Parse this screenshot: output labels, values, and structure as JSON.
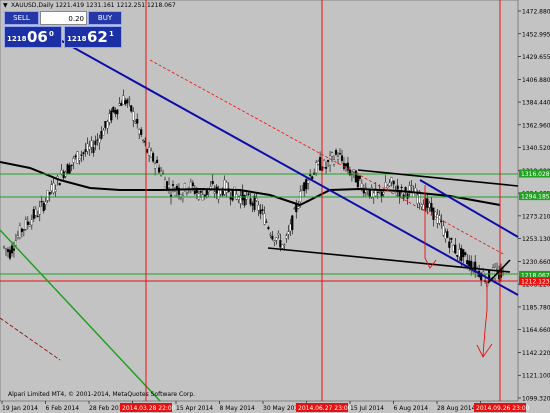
{
  "window": {
    "symbol_arrow": "▼",
    "title": "XAUUSD,Daily  1221.419 1231.161 1212.251 1218.067"
  },
  "trade_panel": {
    "sell_label": "SELL",
    "buy_label": "BUY",
    "lot_value": "0.20",
    "bid": {
      "small": "1218",
      "big": "06",
      "sup": "0"
    },
    "ask": {
      "small": "1218",
      "big": "62",
      "sup": "1"
    }
  },
  "copyright": "Alpari Limited MT4, © 2001-2014, MetaQuotes Software Corp.",
  "price_axis": {
    "labels": [
      "1472.880",
      "1452.995",
      "1429.655",
      "1406.880",
      "1384.440",
      "1362.960",
      "1340.520",
      "1318.080",
      "1294.685",
      "1273.210",
      "1253.130",
      "1230.660",
      "1208.220",
      "1185.780",
      "1164.660",
      "1142.220",
      "1121.100",
      "1099.320"
    ],
    "highlight_labels": [
      {
        "text": "1316.028",
        "price": 1316.0,
        "color": "#22a022"
      },
      {
        "text": "1294.185",
        "price": 1294.2,
        "color": "#22a022"
      },
      {
        "text": "1218.067",
        "price": 1218.1,
        "color": "#22a022"
      },
      {
        "text": "1212.123",
        "price": 1212.1,
        "color": "#e81010"
      }
    ]
  },
  "time_axis": {
    "labels": [
      "19 Jan 2014",
      "6 Feb 2014",
      "28 Feb 2014",
      "19 Mar 2014",
      "15 Apr 2014",
      "8 May 2014",
      "30 May 2014",
      "19 Jun 2014",
      "15 Jul 2014",
      "6 Aug 2014",
      "28 Aug 2014",
      "17 Sep 2014"
    ],
    "highlight_labels": [
      {
        "text": "2014.03.28 22:00"
      },
      {
        "text": "2014.06.27 23:00"
      },
      {
        "text": "2014.09.26 23:00"
      }
    ]
  },
  "colors": {
    "background": "#c3c3c3",
    "bull": "#ffffff",
    "bear": "#000000",
    "channel": "#0d0da8",
    "support": "#22a022",
    "resistance": "#e81010",
    "ma": "#000000"
  },
  "chart_data": {
    "type": "candlestick",
    "symbol": "XAUUSD",
    "timeframe": "Daily",
    "ylim": [
      1099.32,
      1472.88
    ],
    "ohlc_last": {
      "open": 1221.419,
      "high": 1231.161,
      "low": 1212.251,
      "close": 1218.067
    },
    "price_path": [
      1245,
      1240,
      1252,
      1262,
      1268,
      1275,
      1280,
      1290,
      1300,
      1308,
      1318,
      1322,
      1330,
      1335,
      1338,
      1342,
      1352,
      1360,
      1372,
      1380,
      1388,
      1382,
      1368,
      1352,
      1338,
      1330,
      1322,
      1310,
      1300,
      1302,
      1298,
      1305,
      1300,
      1295,
      1298,
      1302,
      1296,
      1303,
      1298,
      1295,
      1293,
      1290,
      1288,
      1280,
      1270,
      1258,
      1252,
      1245,
      1262,
      1282,
      1300,
      1312,
      1318,
      1325,
      1322,
      1330,
      1335,
      1325,
      1318,
      1312,
      1305,
      1300,
      1294,
      1296,
      1302,
      1306,
      1301,
      1296,
      1300,
      1296,
      1290,
      1285,
      1278,
      1270,
      1258,
      1248,
      1240,
      1236,
      1230,
      1225,
      1220,
      1214,
      1220,
      1218
    ],
    "horizontal_levels": [
      1316.0,
      1294.2,
      1218.1,
      1212.1
    ]
  }
}
